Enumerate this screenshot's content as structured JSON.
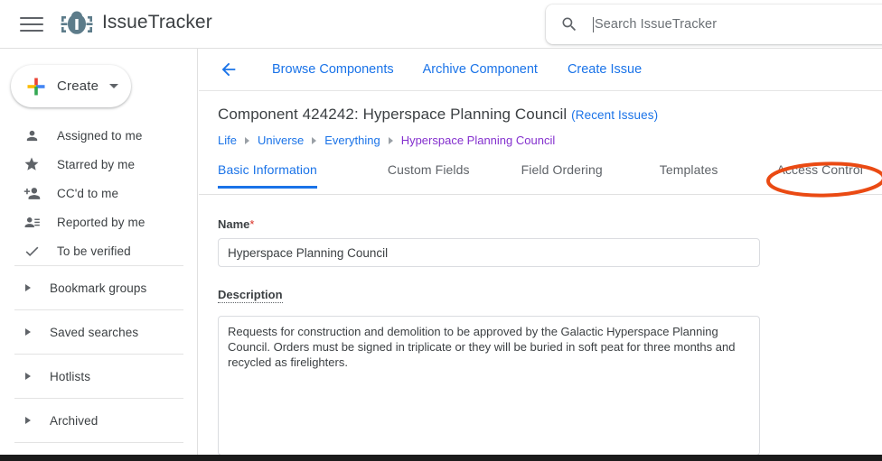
{
  "topbar": {
    "menu_icon": "hamburger-icon",
    "logo_icon": "bug-logo-icon",
    "brand": "IssueTracker",
    "search": {
      "icon": "search-icon",
      "placeholder": "Search IssueTracker",
      "value": ""
    }
  },
  "sidebar": {
    "create": {
      "label": "Create",
      "plus_icon": "google-plus-icon",
      "caret_icon": "chevron-down-icon"
    },
    "items": [
      {
        "label": "Assigned to me",
        "icon": "person-icon"
      },
      {
        "label": "Starred by me",
        "icon": "star-icon"
      },
      {
        "label": "CC'd to me",
        "icon": "person-add-icon"
      },
      {
        "label": "Reported by me",
        "icon": "person-list-icon"
      },
      {
        "label": "To be verified",
        "icon": "check-icon"
      }
    ],
    "groups": [
      {
        "label": "Bookmark groups",
        "icon": "triangle-right-icon"
      },
      {
        "label": "Saved searches",
        "icon": "triangle-right-icon"
      },
      {
        "label": "Hotlists",
        "icon": "triangle-right-icon"
      },
      {
        "label": "Archived",
        "icon": "triangle-right-icon"
      }
    ]
  },
  "main": {
    "back_icon": "back-arrow-icon",
    "actions": [
      {
        "label": "Browse Components"
      },
      {
        "label": "Archive Component"
      },
      {
        "label": "Create Issue"
      }
    ],
    "title": "Component 424242: Hyperspace Planning Council",
    "title_link": "(Recent Issues)",
    "breadcrumb": [
      {
        "label": "Life",
        "visited": false
      },
      {
        "label": "Universe",
        "visited": false
      },
      {
        "label": "Everything",
        "visited": false
      },
      {
        "label": "Hyperspace Planning Council",
        "visited": true
      }
    ],
    "tabs": [
      {
        "label": "Basic Information",
        "active": true
      },
      {
        "label": "Custom Fields",
        "active": false
      },
      {
        "label": "Field Ordering",
        "active": false
      },
      {
        "label": "Templates",
        "active": false
      },
      {
        "label": "Access Control",
        "active": false
      }
    ],
    "form": {
      "name_label": "Name",
      "name_required": "*",
      "name_value": "Hyperspace Planning Council",
      "name_placeholder": "",
      "description_label": "Description",
      "description_value": "Requests for construction and demolition to be approved by the Galactic Hyperspace Planning Council. Orders must be signed in triplicate or they will be buried in soft peat for three months and recycled as firelighters.",
      "description_placeholder": ""
    }
  },
  "annotation": {
    "target": "Access Control",
    "shape": "ellipse-highlight",
    "color": "#EA4A13"
  },
  "colors": {
    "accent_blue": "#1a73e8",
    "visited_purple": "#8430ce",
    "required_red": "#d93025",
    "logo_slate": "#5d7c8a",
    "annotation_orange": "#EA4A13",
    "text_primary": "#3c4043",
    "text_secondary": "#5f6368",
    "border": "#dadce0"
  }
}
